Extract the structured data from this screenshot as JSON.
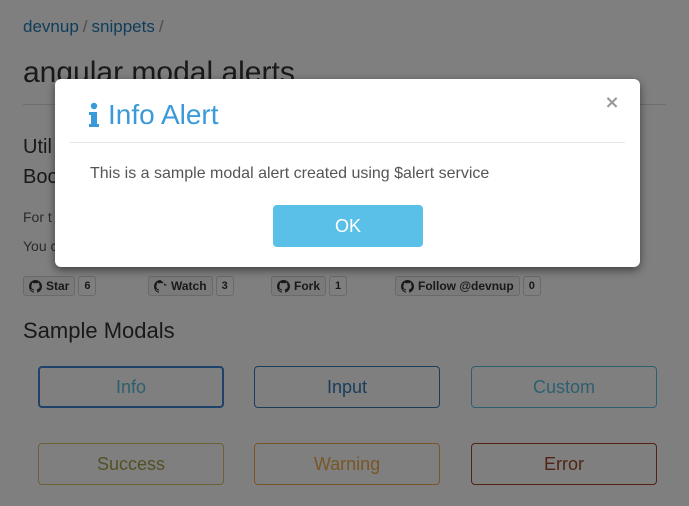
{
  "breadcrumb": {
    "item1": "devnup",
    "sep1": "/",
    "item2": "snippets",
    "sep2": "/"
  },
  "page_title": "angular modal alerts",
  "section_heading": {
    "line1": "Util",
    "line2": "Boo"
  },
  "paragraphs": {
    "p1": "For t",
    "p2": "You c"
  },
  "github_buttons": [
    {
      "label": "Star",
      "count": "6",
      "icon": "github-icon"
    },
    {
      "label": "Watch",
      "count": "3",
      "icon": "github-icon"
    },
    {
      "label": "Fork",
      "count": "1",
      "icon": "github-icon"
    },
    {
      "label": "Follow @devnup",
      "count": "0",
      "icon": "github-icon"
    }
  ],
  "sample_heading": "Sample Modals",
  "sample_buttons": {
    "info": "Info",
    "input": "Input",
    "custom": "Custom",
    "success": "Success",
    "warning": "Warning",
    "error": "Error"
  },
  "modal": {
    "title": "Info Alert",
    "title_icon": "info-icon",
    "close": "×",
    "body": "This is a sample modal alert created using $alert service",
    "ok_label": "OK"
  },
  "colors": {
    "accent": "#3a9ad9",
    "ok_button": "#5bc0e8",
    "link": "#1f7bb6"
  }
}
